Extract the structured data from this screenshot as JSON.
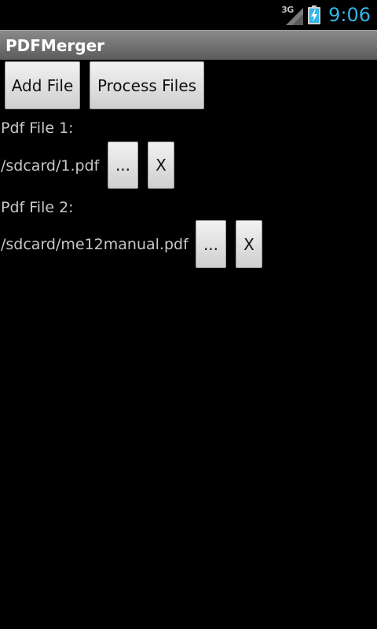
{
  "status_bar": {
    "network_type": "3G",
    "time": "9:06",
    "icons": [
      "signal-icon",
      "battery-charging-icon"
    ]
  },
  "app": {
    "title": "PDFMerger"
  },
  "toolbar": {
    "add_file_label": "Add File",
    "process_files_label": "Process Files"
  },
  "files": [
    {
      "label": "Pdf File 1:",
      "path": "/sdcard/1.pdf",
      "browse_label": "...",
      "remove_label": "X"
    },
    {
      "label": "Pdf File 2:",
      "path": "/sdcard/me12manual.pdf",
      "browse_label": "...",
      "remove_label": "X"
    }
  ],
  "colors": {
    "background": "#000000",
    "clock": "#33b5e5",
    "title_bar": "#7a7a7a",
    "text": "#c8c8c8"
  }
}
